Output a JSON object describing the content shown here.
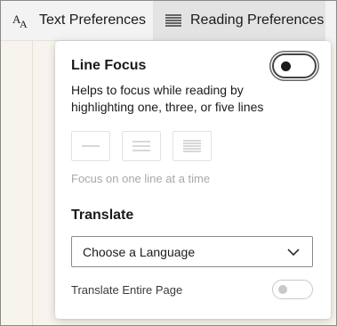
{
  "toolbar": {
    "tabs": [
      {
        "label": "Text Preferences",
        "icon": "text-size-icon",
        "active": false
      },
      {
        "label": "Reading Preferences",
        "icon": "reading-lines-icon",
        "active": true
      }
    ]
  },
  "panel": {
    "line_focus": {
      "title": "Line Focus",
      "description": "Helps to focus while reading by highlighting one, three, or five lines",
      "toggle_on": true,
      "options": [
        {
          "name": "one-line-option",
          "lines": 1
        },
        {
          "name": "three-lines-option",
          "lines": 3
        },
        {
          "name": "five-lines-option",
          "lines": 5
        }
      ],
      "hint": "Focus on one line at a time"
    },
    "translate": {
      "title": "Translate",
      "language_select": "Choose a Language",
      "entire_page_label": "Translate Entire Page",
      "entire_page_on": false
    }
  },
  "colors": {
    "toolbar_bg": "#f3f3f3",
    "active_tab_bg": "#e3e3e3",
    "page_bg": "#f7f4ee",
    "disabled_text": "#a8a8a8"
  }
}
